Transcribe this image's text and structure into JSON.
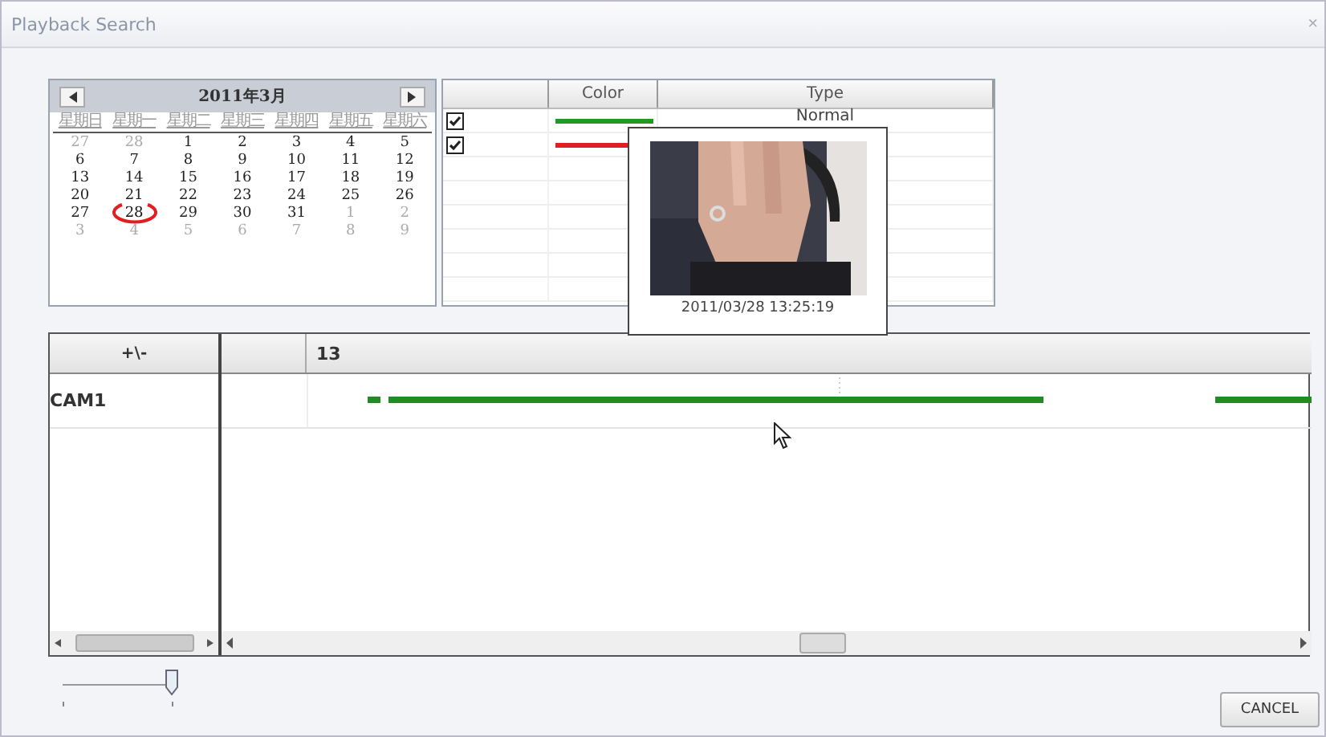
{
  "window": {
    "title": "Playback Search",
    "close": "×"
  },
  "calendar": {
    "month": "2011年3月",
    "weekdays": [
      "星期日",
      "星期一",
      "星期二",
      "星期三",
      "星期四",
      "星期五",
      "星期六"
    ],
    "days": [
      {
        "label": "27",
        "other_month": true,
        "selected": false
      },
      {
        "label": "28",
        "other_month": true,
        "selected": false
      },
      {
        "label": "1",
        "other_month": false,
        "selected": false
      },
      {
        "label": "2",
        "other_month": false,
        "selected": false
      },
      {
        "label": "3",
        "other_month": false,
        "selected": false
      },
      {
        "label": "4",
        "other_month": false,
        "selected": false
      },
      {
        "label": "5",
        "other_month": false,
        "selected": false
      },
      {
        "label": "6",
        "other_month": false,
        "selected": false
      },
      {
        "label": "7",
        "other_month": false,
        "selected": false
      },
      {
        "label": "8",
        "other_month": false,
        "selected": false
      },
      {
        "label": "9",
        "other_month": false,
        "selected": false
      },
      {
        "label": "10",
        "other_month": false,
        "selected": false
      },
      {
        "label": "11",
        "other_month": false,
        "selected": false
      },
      {
        "label": "12",
        "other_month": false,
        "selected": false
      },
      {
        "label": "13",
        "other_month": false,
        "selected": false
      },
      {
        "label": "14",
        "other_month": false,
        "selected": false
      },
      {
        "label": "15",
        "other_month": false,
        "selected": false
      },
      {
        "label": "16",
        "other_month": false,
        "selected": false
      },
      {
        "label": "17",
        "other_month": false,
        "selected": false
      },
      {
        "label": "18",
        "other_month": false,
        "selected": false
      },
      {
        "label": "19",
        "other_month": false,
        "selected": false
      },
      {
        "label": "20",
        "other_month": false,
        "selected": false
      },
      {
        "label": "21",
        "other_month": false,
        "selected": false
      },
      {
        "label": "22",
        "other_month": false,
        "selected": false
      },
      {
        "label": "23",
        "other_month": false,
        "selected": false
      },
      {
        "label": "24",
        "other_month": false,
        "selected": false
      },
      {
        "label": "25",
        "other_month": false,
        "selected": false
      },
      {
        "label": "26",
        "other_month": false,
        "selected": false
      },
      {
        "label": "27",
        "other_month": false,
        "selected": false
      },
      {
        "label": "28",
        "other_month": false,
        "selected": true
      },
      {
        "label": "29",
        "other_month": false,
        "selected": false
      },
      {
        "label": "30",
        "other_month": false,
        "selected": false
      },
      {
        "label": "31",
        "other_month": false,
        "selected": false
      },
      {
        "label": "1",
        "other_month": true,
        "selected": false
      },
      {
        "label": "2",
        "other_month": true,
        "selected": false
      },
      {
        "label": "3",
        "other_month": true,
        "selected": false
      },
      {
        "label": "4",
        "other_month": true,
        "selected": false
      },
      {
        "label": "5",
        "other_month": true,
        "selected": false
      },
      {
        "label": "6",
        "other_month": true,
        "selected": false
      },
      {
        "label": "7",
        "other_month": true,
        "selected": false
      },
      {
        "label": "8",
        "other_month": true,
        "selected": false
      },
      {
        "label": "9",
        "other_month": true,
        "selected": false
      }
    ]
  },
  "event_table": {
    "columns": [
      "Color",
      "Type"
    ],
    "rows": [
      {
        "checked": true,
        "color": "#229922",
        "type": "Normal"
      },
      {
        "checked": true,
        "color": "#e02020"
      }
    ]
  },
  "preview": {
    "kind": "picture",
    "time": "2011/03/28 13:25:19"
  },
  "timeline": {
    "zoom_label": "+\\-",
    "hour": "13",
    "channels": [
      "CAM1"
    ]
  },
  "zoom_slider": {
    "level": 1
  },
  "buttons": [
    "CANCEL"
  ]
}
